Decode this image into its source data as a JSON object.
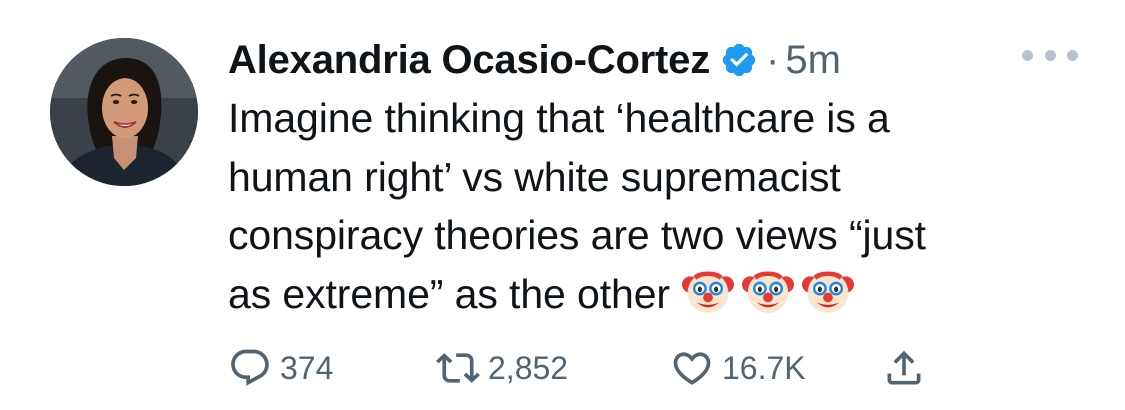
{
  "tweet": {
    "author": {
      "display_name": "Alexandria Ocasio-Cortez",
      "verified_icon": "verified-badge-icon",
      "avatar": "profile-photo"
    },
    "separator": "·",
    "timestamp": "5m",
    "more_icon": "more-horizontal-icon",
    "text_lines": [
      "Imagine thinking that ‘healthcare is a",
      "human right’ vs white supremacist",
      "conspiracy theories are two views “just",
      "as extreme” as the other"
    ],
    "emojis": [
      "clown-face",
      "clown-face",
      "clown-face"
    ],
    "actions": {
      "reply": {
        "icon": "reply-icon",
        "count": "374"
      },
      "retweet": {
        "icon": "retweet-icon",
        "count": "2,852"
      },
      "like": {
        "icon": "heart-icon",
        "count": "16.7K"
      },
      "share": {
        "icon": "share-icon"
      }
    }
  },
  "colors": {
    "text": "#0f1419",
    "secondary": "#536471",
    "verified": "#1d9bf0",
    "background": "#ffffff"
  }
}
